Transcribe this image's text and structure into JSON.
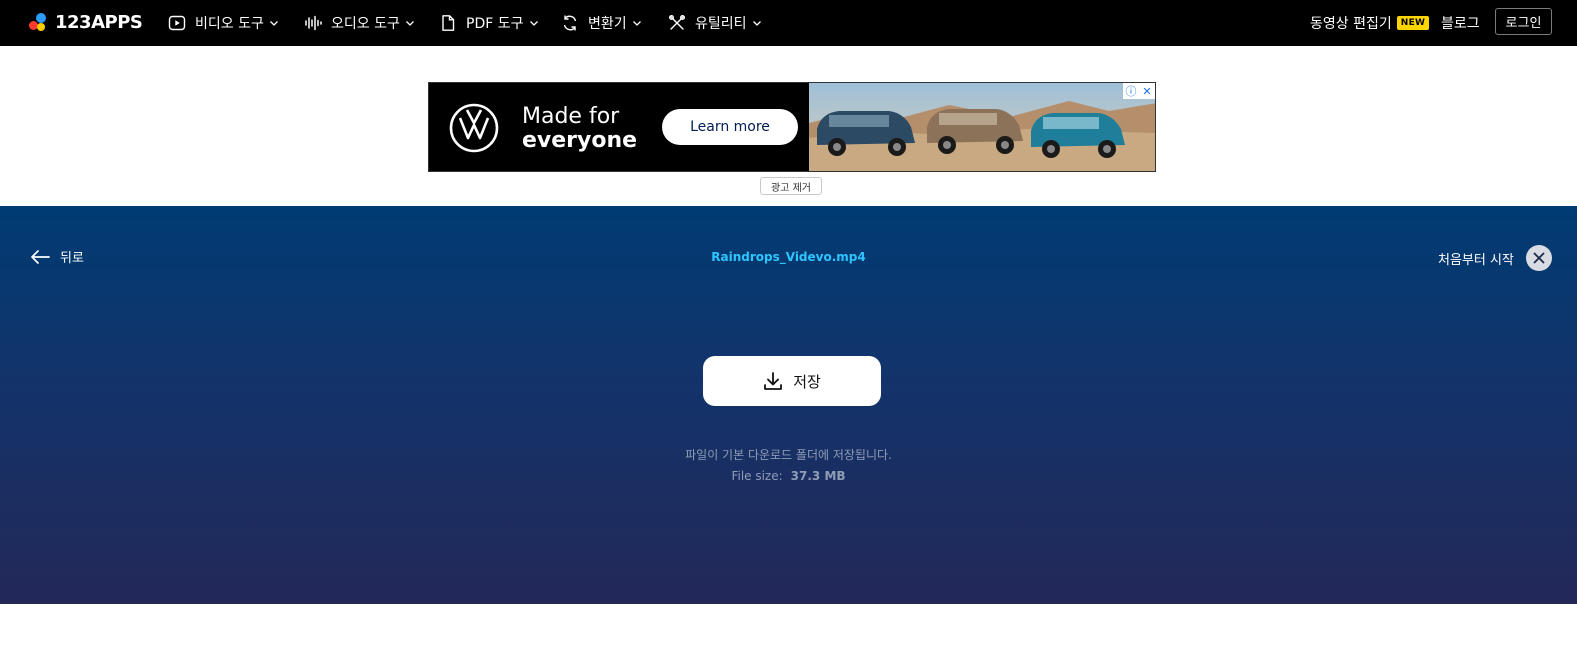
{
  "brand": {
    "name": "123APPS",
    "dot_colors": [
      "#ff3b30",
      "#ffcc00",
      "#2d9cff"
    ]
  },
  "nav": {
    "items": [
      {
        "label": "비디오 도구",
        "icon": "play-icon"
      },
      {
        "label": "오디오 도구",
        "icon": "waveform-icon"
      },
      {
        "label": "PDF 도구",
        "icon": "document-icon"
      },
      {
        "label": "변환기",
        "icon": "convert-icon"
      },
      {
        "label": "유틸리티",
        "icon": "tools-icon"
      }
    ],
    "video_editor_label": "동영상 편집기",
    "new_badge": "NEW",
    "blog_label": "블로그",
    "login_label": "로그인"
  },
  "ad": {
    "headline_line1": "Made for",
    "headline_line2": "everyone",
    "cta_label": "Learn more",
    "remove_ads_label": "광고 제거",
    "info_icon": "info-icon",
    "close_icon": "close-icon"
  },
  "panel": {
    "back_label": "뒤로",
    "file_name": "Raindrops_Videvo.mp4",
    "restart_label": "처음부터 시작",
    "save_label": "저장",
    "save_note": "파일이 기본 다운로드 폴더에 저장됩니다.",
    "file_size_label": "File size:",
    "file_size_value": "37.3 MB"
  },
  "colors": {
    "accent_filename": "#2ec5ff",
    "panel_top": "#003b73",
    "panel_bottom": "#232858",
    "new_badge": "#ffd500"
  }
}
